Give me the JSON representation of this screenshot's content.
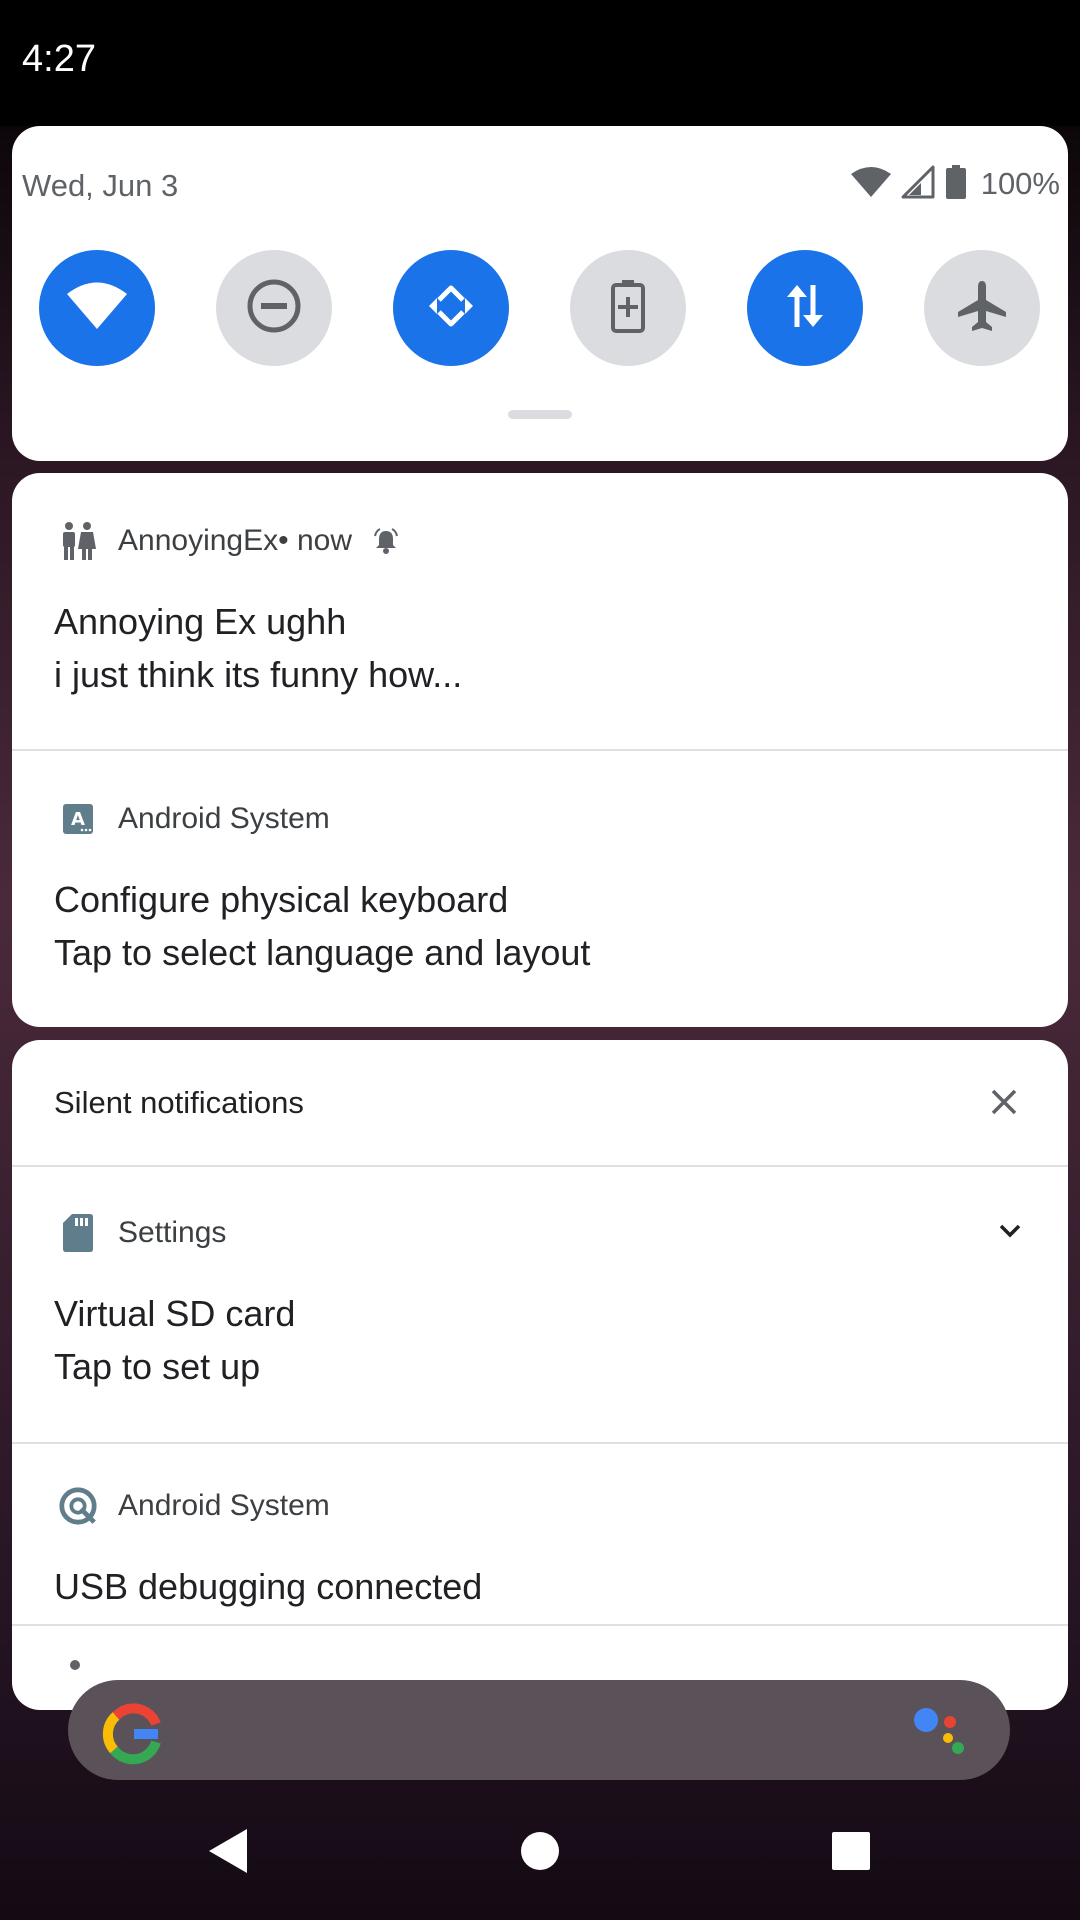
{
  "status_bar": {
    "time": "4:27"
  },
  "quick_settings": {
    "date": "Wed, Jun 3",
    "battery_percent": "100%",
    "tiles": [
      {
        "name": "wifi",
        "state": "on"
      },
      {
        "name": "do-not-disturb",
        "state": "off"
      },
      {
        "name": "auto-rotate",
        "state": "on"
      },
      {
        "name": "battery-saver",
        "state": "off"
      },
      {
        "name": "mobile-data",
        "state": "on"
      },
      {
        "name": "airplane-mode",
        "state": "off"
      }
    ]
  },
  "notifications": [
    {
      "app": "AnnoyingEx",
      "meta": " • now",
      "icon": "couple-icon",
      "title": "Annoying Ex ughh",
      "text": "i just think its funny how..."
    },
    {
      "app": "Android System",
      "icon": "keyboard-language-icon",
      "title": "Configure physical keyboard",
      "text": "Tap to select language and layout"
    }
  ],
  "silent_section": {
    "header": "Silent notifications",
    "items": [
      {
        "app": "Settings",
        "icon": "sd-card-icon",
        "title": "Virtual SD card",
        "text": "Tap to set up"
      },
      {
        "app": "Android System",
        "icon": "android-debug-icon",
        "title": "USB debugging connected"
      }
    ]
  },
  "colors": {
    "accent": "#1a73e8",
    "tile_off": "#dadce0",
    "panel_bg": "#ffffff"
  }
}
